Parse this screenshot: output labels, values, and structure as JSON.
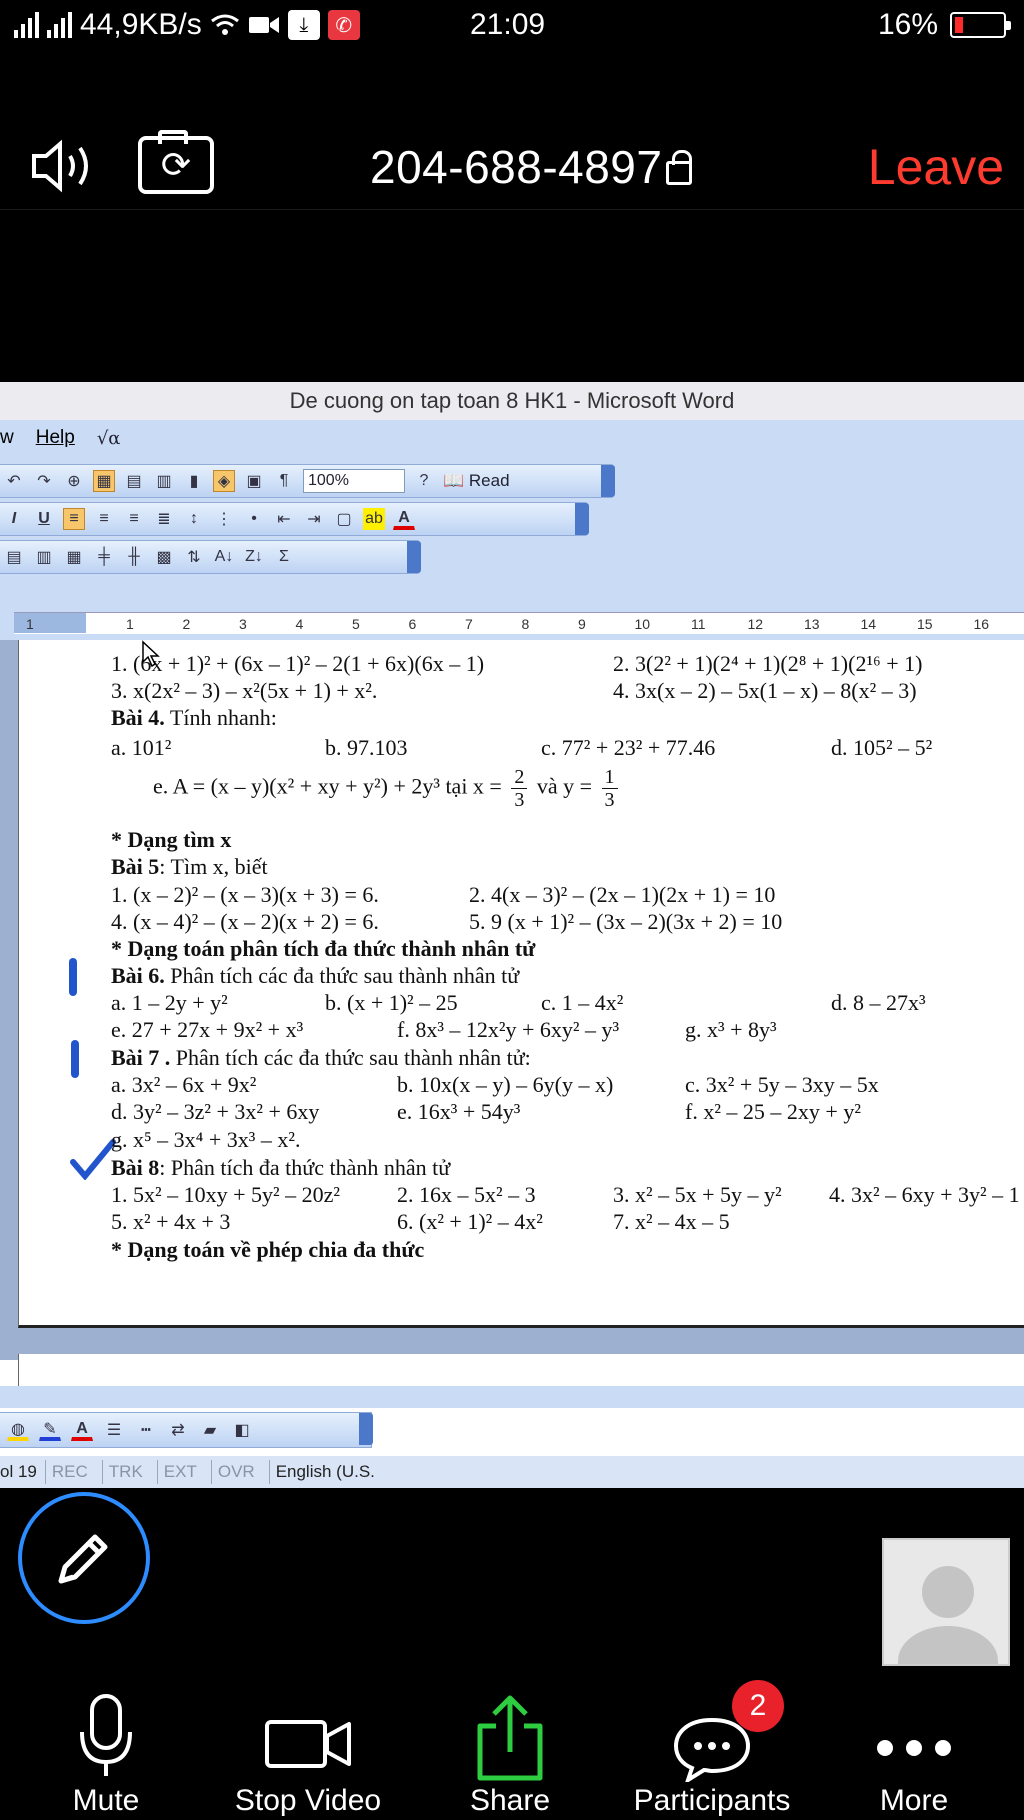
{
  "status_bar": {
    "network_speed": "44,9KB/s",
    "time": "21:09",
    "battery": "16%",
    "battery_level": 0.16
  },
  "meeting": {
    "meeting_id": "204-688-4897",
    "leave_label": "Leave"
  },
  "word": {
    "title": "De cuong on tap toan 8 HK1 - Microsoft Word",
    "menu": {
      "help": "Help"
    },
    "zoom": "100%",
    "read_label": "Read",
    "ruler_ticks": [
      "1",
      "1",
      "2",
      "3",
      "4",
      "5",
      "6",
      "7",
      "8",
      "9",
      "10",
      "11",
      "12",
      "13",
      "14",
      "15",
      "16"
    ],
    "doc_lines": [
      "1. (6x + 1)² + (6x – 1)² – 2(1 + 6x)(6x – 1)",
      "2. 3(2² + 1)(2⁴ + 1)(2⁸ + 1)(2¹⁶ + 1)",
      "3. x(2x² – 3) – x²(5x + 1) + x².",
      "4. 3x(x – 2) – 5x(1 – x) – 8(x² – 3)",
      "Bài 4.",
      " Tính nhanh:",
      "a. 101²",
      "b. 97.103",
      "c. 77² + 23² + 77.46",
      "d. 105² – 5²",
      "e. A = (x – y)(x² + xy + y²) + 2y³ tại x = ",
      "2",
      "3",
      " và y = ",
      "1",
      "3",
      "* Dạng tìm x",
      "Bài 5",
      ": Tìm x, biết",
      "1. (x – 2)² – (x – 3)(x + 3) = 6.",
      "2. 4(x – 3)² – (2x – 1)(2x + 1) = 10",
      "4. (x – 4)² – (x – 2)(x + 2) = 6.",
      "5. 9 (x + 1)² – (3x – 2)(3x + 2) = 10",
      "* Dạng toán phân tích đa thức thành nhân tử",
      "Bài 6.",
      " Phân tích các đa thức sau thành nhân tử",
      "a. 1 – 2y + y²",
      "b. (x + 1)² – 25",
      "c. 1 – 4x²",
      "d. 8 – 27x³",
      "e. 27 + 27x + 9x² + x³",
      "f. 8x³ – 12x²y + 6xy² – y³",
      "g. x³ + 8y³",
      "Bài 7 .",
      " Phân tích các đa thức sau thành nhân tử:",
      "a. 3x² – 6x + 9x²",
      "b. 10x(x – y) – 6y(y – x)",
      "c. 3x² + 5y – 3xy – 5x",
      "d. 3y² – 3z² + 3x² + 6xy",
      "e. 16x³ + 54y³",
      "f. x² – 25 – 2xy + y²",
      "g. x⁵ – 3x⁴ + 3x³ – x².",
      "Bài 8",
      ": Phân tích đa thức thành nhân tử",
      "1. 5x² – 10xy + 5y² – 20z²",
      "2. 16x – 5x² – 3",
      "3. x² – 5x + 5y – y²",
      "4. 3x² – 6xy + 3y² – 1",
      "5. x² + 4x + 3",
      "6. (x² + 1)² – 4x²",
      "7. x² – 4x – 5",
      "* Dạng toán về phép chia đa thức"
    ],
    "status": {
      "col": "ol 19",
      "rec": "REC",
      "trk": "TRK",
      "ext": "EXT",
      "ovr": "OVR",
      "language": "English (U.S."
    }
  },
  "bottom_bar": {
    "mute": "Mute",
    "stop_video": "Stop Video",
    "share": "Share",
    "participants": "Participants",
    "participants_count": "2",
    "more": "More"
  },
  "colors": {
    "leave": "#ff3b30",
    "share_green": "#2ecc40",
    "annotate_ring": "#2d8cff",
    "badge": "#e8212b"
  }
}
